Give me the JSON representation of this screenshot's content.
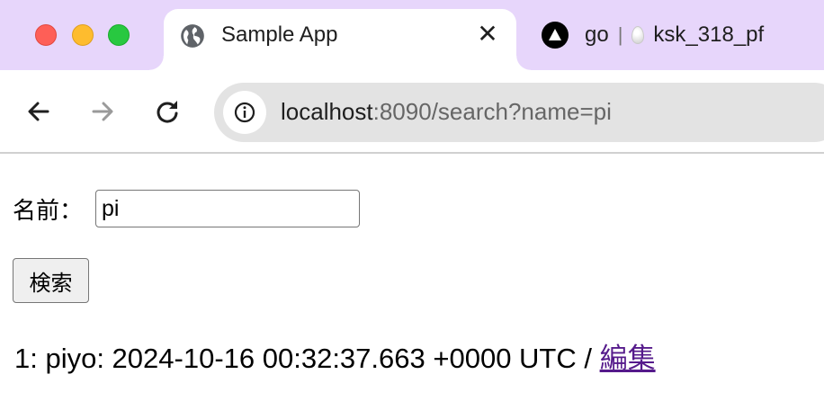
{
  "browser": {
    "active_tab": {
      "title": "Sample App",
      "favicon": "globe-icon",
      "close": "✕"
    },
    "inactive_tab": {
      "title_prefix": "go",
      "separator": "|",
      "title_suffix": "ksk_318_pf",
      "favicon": "triangle-logo-icon"
    },
    "address": {
      "host": "localhost",
      "rest": ":8090/search?name=pi"
    }
  },
  "page": {
    "form": {
      "label": "名前：",
      "input_value": "pi",
      "search_button": "検索"
    },
    "results": [
      {
        "text": "1: piyo: 2024-10-16 00:32:37.663 +0000 UTC / ",
        "link": "編集"
      }
    ]
  },
  "colors": {
    "tab_strip": "#e7d6fb",
    "link_visited": "#551a8b"
  }
}
